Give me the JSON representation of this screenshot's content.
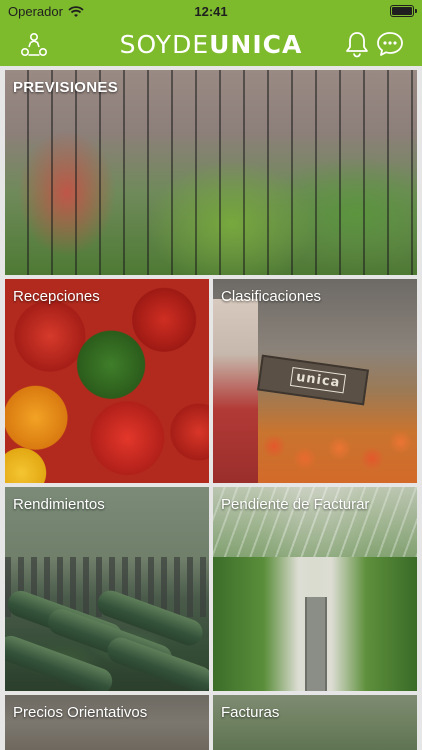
{
  "status_bar": {
    "carrier": "Operador",
    "time": "12:41",
    "battery_level": 1.0
  },
  "nav_bar": {
    "logo_part1": "SOYDE",
    "logo_part2": "UNICA",
    "left_icon": "network-people-icon",
    "right_icons": [
      "bell-icon",
      "chat-bubble-icon"
    ],
    "background_color": "#7dba2c"
  },
  "tiles": [
    {
      "label": "PREVISIONES"
    },
    {
      "label": "Recepciones"
    },
    {
      "label": "Clasificaciones",
      "box_text": "unica"
    },
    {
      "label": "Rendimientos"
    },
    {
      "label": "Pendiente de Facturar"
    },
    {
      "label": "Precios Orientativos"
    },
    {
      "label": "Facturas"
    }
  ]
}
